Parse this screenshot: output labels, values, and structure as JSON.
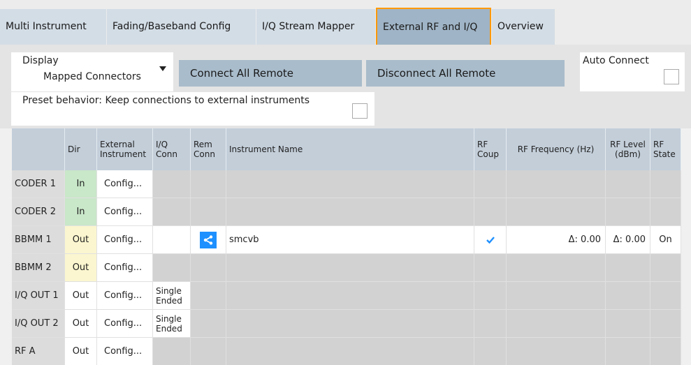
{
  "tabs": [
    {
      "label": "Multi Instrument",
      "active": false
    },
    {
      "label": "Fading/Baseband Config",
      "active": false
    },
    {
      "label": "I/Q Stream Mapper",
      "active": false
    },
    {
      "label": "External RF and I/Q",
      "active": true
    },
    {
      "label": "Overview",
      "active": false
    }
  ],
  "controls": {
    "display_label_line1": "Display",
    "display_label_line2": "Mapped Connectors",
    "connect_all_label": "Connect All Remote",
    "disconnect_all_label": "Disconnect All Remote",
    "auto_connect_label": "Auto Connect",
    "auto_connect_checked": false,
    "preset_label": "Preset behavior: Keep connections to external instruments",
    "preset_checked": false
  },
  "table": {
    "headers": {
      "conn": "",
      "dir": "Dir",
      "ext_instr": "External Instrument",
      "iq_conn": "I/Q Conn",
      "rem_conn": "Rem Conn",
      "instr_name": "Instrument Name",
      "rf_coup": "RF Coup",
      "rf_freq": "RF Frequency (Hz)",
      "rf_level": "RF Level (dBm)",
      "rf_state": "RF State"
    },
    "rows": [
      {
        "name": "CODER 1",
        "dir": "In",
        "config": "Config...",
        "iq": "",
        "rem": false,
        "instr": "",
        "coup": false,
        "freq": "",
        "level": "",
        "state": ""
      },
      {
        "name": "CODER 2",
        "dir": "In",
        "config": "Config...",
        "iq": "",
        "rem": false,
        "instr": "",
        "coup": false,
        "freq": "",
        "level": "",
        "state": ""
      },
      {
        "name": "BBMM 1",
        "dir": "Out",
        "config": "Config...",
        "iq": "",
        "rem": true,
        "instr": "smcvb",
        "coup": true,
        "freq": "Δ: 0.00",
        "level": "Δ: 0.00",
        "state": "On"
      },
      {
        "name": "BBMM 2",
        "dir": "Out",
        "config": "Config...",
        "iq": "",
        "rem": false,
        "instr": "",
        "coup": false,
        "freq": "",
        "level": "",
        "state": ""
      },
      {
        "name": "I/Q OUT 1",
        "dir": "Out",
        "config": "Config...",
        "iq": "Single Ended",
        "rem": false,
        "instr": "",
        "coup": false,
        "freq": "",
        "level": "",
        "state": ""
      },
      {
        "name": "I/Q OUT 2",
        "dir": "Out",
        "config": "Config...",
        "iq": "Single Ended",
        "rem": false,
        "instr": "",
        "coup": false,
        "freq": "",
        "level": "",
        "state": ""
      },
      {
        "name": "RF A",
        "dir": "Out",
        "config": "Config...",
        "iq": "",
        "rem": false,
        "instr": "",
        "coup": false,
        "freq": "",
        "level": "",
        "state": ""
      }
    ]
  },
  "icons": {
    "dropdown_arrow": "chevron-down-icon",
    "remote_connect": "share-icon",
    "checkmark": "checkmark-icon"
  },
  "colors": {
    "active_tab_border": "#ff9900",
    "dir_in": "#c9e7c9",
    "dir_out": "#fbf6cf",
    "share_icon_bg": "#1e90ff"
  }
}
